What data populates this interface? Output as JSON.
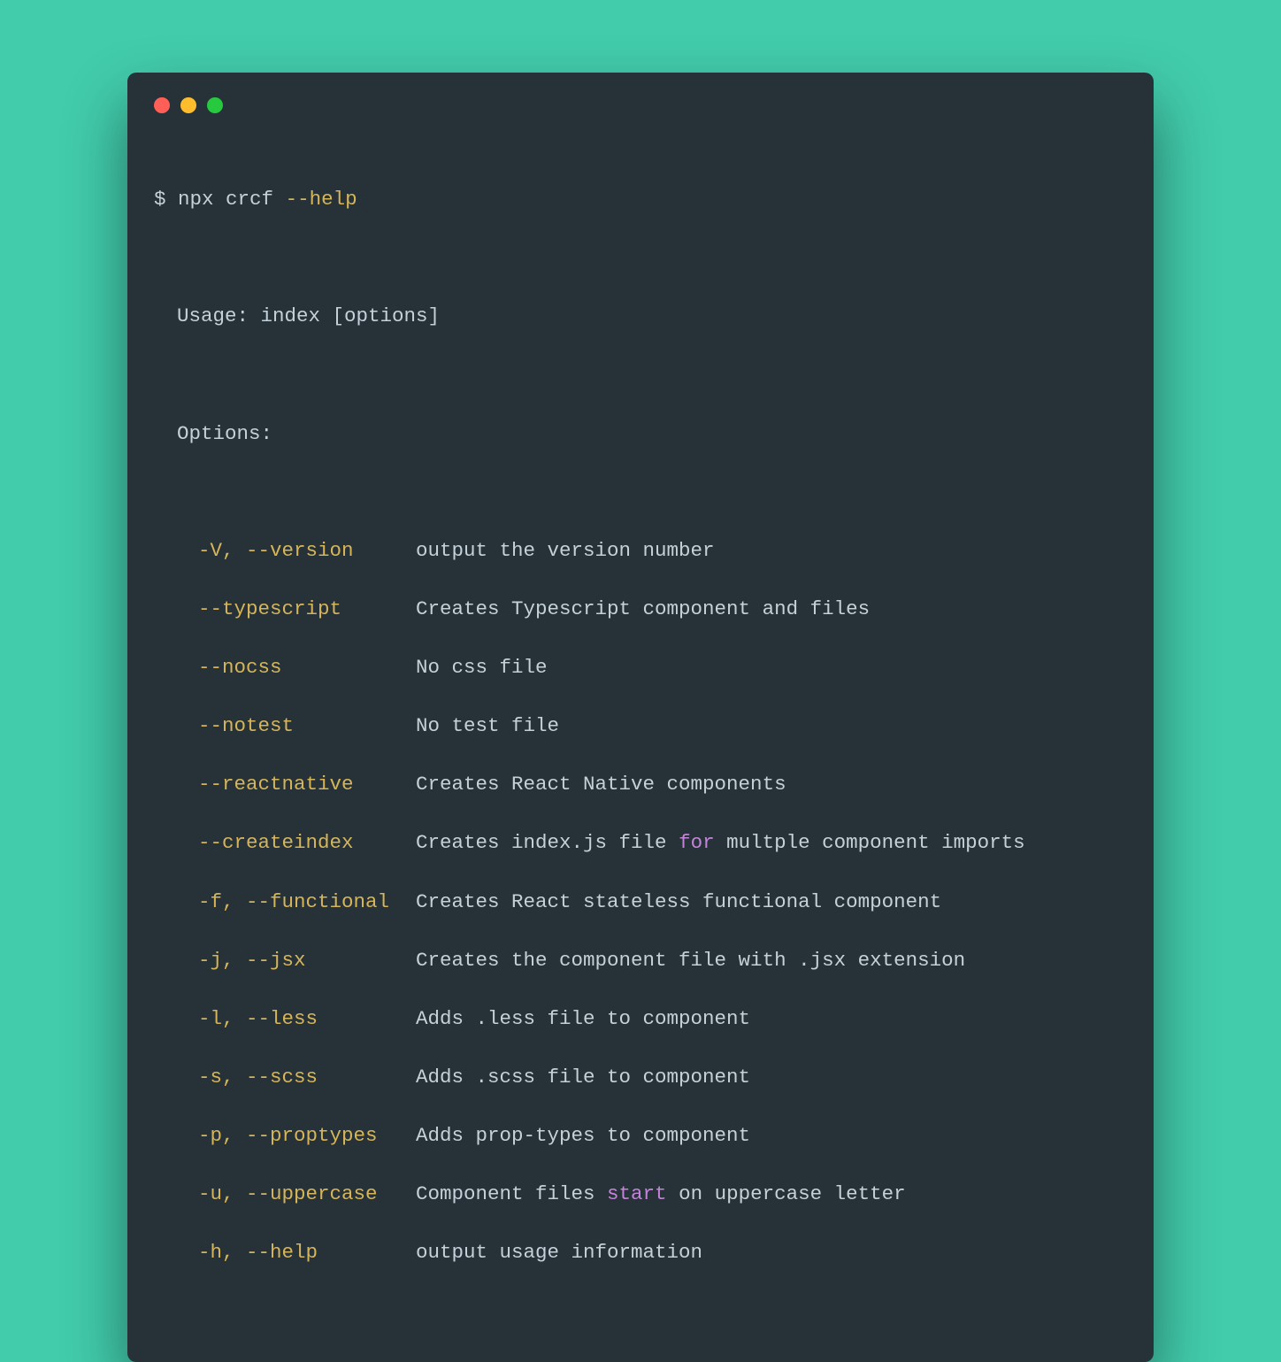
{
  "terminal": {
    "prompt_symbol": "$",
    "command_base": "npx crcf ",
    "command_flag": "--help",
    "usage_line": "Usage: index [options]",
    "options_header": "Options:",
    "options": [
      {
        "flags": "-V, --version",
        "desc": "output the version number"
      },
      {
        "flags": "--typescript",
        "desc": "Creates Typescript component and files"
      },
      {
        "flags": "--nocss",
        "desc": "No css file"
      },
      {
        "flags": "--notest",
        "desc": "No test file"
      },
      {
        "flags": "--reactnative",
        "desc": "Creates React Native components"
      },
      {
        "flags": "--createindex",
        "desc_pre": "Creates index.js file ",
        "desc_kw": "for",
        "desc_post": " multple component imports"
      },
      {
        "flags": "-f, --functional",
        "desc": "Creates React stateless functional component"
      },
      {
        "flags": "-j, --jsx",
        "desc": "Creates the component file with .jsx extension"
      },
      {
        "flags": "-l, --less",
        "desc": "Adds .less file to component"
      },
      {
        "flags": "-s, --scss",
        "desc": "Adds .scss file to component"
      },
      {
        "flags": "-p, --proptypes",
        "desc": "Adds prop-types to component"
      },
      {
        "flags": "-u, --uppercase",
        "desc_pre": "Component files ",
        "desc_kw": "start",
        "desc_post": " on uppercase letter"
      },
      {
        "flags": "-h, --help",
        "desc": "output usage information"
      }
    ]
  },
  "colors": {
    "background": "#42ccac",
    "terminal_bg": "#263238",
    "text": "#c5d1d9",
    "flag": "#d6b55a",
    "keyword": "#c383d9",
    "red": "#ff5f56",
    "yellow": "#ffbd2e",
    "green": "#27c93f"
  }
}
